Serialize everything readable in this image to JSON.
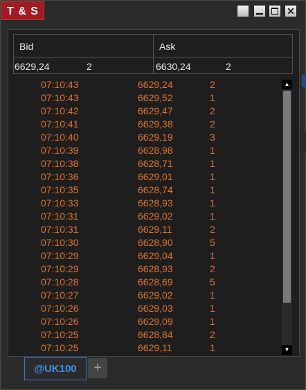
{
  "window": {
    "title": "T & S",
    "controls": {
      "close_glyph": "✕"
    }
  },
  "quote": {
    "bid_label": "Bid",
    "ask_label": "Ask",
    "bid_price": "6629,24",
    "bid_size": "2",
    "ask_price": "6630,24",
    "ask_size": "2"
  },
  "trades": [
    {
      "time": "07:10:43",
      "price": "6629,24",
      "size": "2"
    },
    {
      "time": "07:10:43",
      "price": "6629,52",
      "size": "1"
    },
    {
      "time": "07:10:42",
      "price": "6629,47",
      "size": "2"
    },
    {
      "time": "07:10:41",
      "price": "6629,38",
      "size": "2"
    },
    {
      "time": "07:10:40",
      "price": "6629,19",
      "size": "3"
    },
    {
      "time": "07:10:39",
      "price": "6628,98",
      "size": "1"
    },
    {
      "time": "07:10:38",
      "price": "6628,71",
      "size": "1"
    },
    {
      "time": "07:10:36",
      "price": "6629,01",
      "size": "1"
    },
    {
      "time": "07:10:35",
      "price": "6628,74",
      "size": "1"
    },
    {
      "time": "07:10:33",
      "price": "6628,93",
      "size": "1"
    },
    {
      "time": "07:10:31",
      "price": "6629,02",
      "size": "1"
    },
    {
      "time": "07:10:31",
      "price": "6629,11",
      "size": "2"
    },
    {
      "time": "07:10:30",
      "price": "6628,90",
      "size": "5"
    },
    {
      "time": "07:10:29",
      "price": "6629,04",
      "size": "1"
    },
    {
      "time": "07:10:29",
      "price": "6628,93",
      "size": "2"
    },
    {
      "time": "07:10:28",
      "price": "6628,69",
      "size": "5"
    },
    {
      "time": "07:10:27",
      "price": "6629,02",
      "size": "1"
    },
    {
      "time": "07:10:26",
      "price": "6629,03",
      "size": "1"
    },
    {
      "time": "07:10:26",
      "price": "6629,09",
      "size": "1"
    },
    {
      "time": "07:10:25",
      "price": "6628,84",
      "size": "2"
    },
    {
      "time": "07:10:25",
      "price": "6629,11",
      "size": "1"
    }
  ],
  "tabs": {
    "active_label": "@UK100",
    "add_label": "+"
  },
  "colors": {
    "title_bg": "#a01c22",
    "trade_text": "#e0732a",
    "active_tab": "#3d8fe8"
  }
}
